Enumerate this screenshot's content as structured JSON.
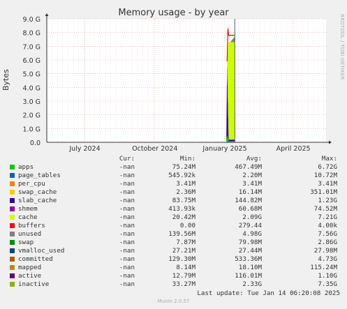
{
  "title": "Memory usage - by year",
  "side_label": "RRDTOOL / TOBI OETIKER",
  "footer": "Munin 2.0.57",
  "last_update": "Last update: Tue Jan 14 06:20:08 2025",
  "legend_headers": {
    "cur": "Cur:",
    "min": "Min:",
    "avg": "Avg:",
    "max": "Max:"
  },
  "legend": [
    {
      "name": "apps",
      "color": "#00cc00",
      "cur": "-nan",
      "min": "75.24M",
      "avg": "467.49M",
      "max": "6.72G"
    },
    {
      "name": "page_tables",
      "color": "#0066b3",
      "cur": "-nan",
      "min": "545.92k",
      "avg": "2.20M",
      "max": "10.72M"
    },
    {
      "name": "per_cpu",
      "color": "#ff8000",
      "cur": "-nan",
      "min": "3.41M",
      "avg": "3.41M",
      "max": "3.41M"
    },
    {
      "name": "swap_cache",
      "color": "#ffcc00",
      "cur": "-nan",
      "min": "2.36M",
      "avg": "16.14M",
      "max": "351.01M"
    },
    {
      "name": "slab_cache",
      "color": "#330099",
      "cur": "-nan",
      "min": "83.75M",
      "avg": "144.82M",
      "max": "1.23G"
    },
    {
      "name": "shmem",
      "color": "#990099",
      "cur": "-nan",
      "min": "413.93k",
      "avg": "60.68M",
      "max": "74.52M"
    },
    {
      "name": "cache",
      "color": "#ccff00",
      "cur": "-nan",
      "min": "20.42M",
      "avg": "2.09G",
      "max": "7.21G"
    },
    {
      "name": "buffers",
      "color": "#ff0000",
      "cur": "-nan",
      "min": "0.00",
      "avg": "279.44",
      "max": "4.00k"
    },
    {
      "name": "unused",
      "color": "#808080",
      "cur": "-nan",
      "min": "139.56M",
      "avg": "4.98G",
      "max": "7.56G"
    },
    {
      "name": "swap",
      "color": "#008f00",
      "cur": "-nan",
      "min": "7.87M",
      "avg": "79.98M",
      "max": "2.86G"
    },
    {
      "name": "vmalloc_used",
      "color": "#00487d",
      "cur": "-nan",
      "min": "27.21M",
      "avg": "27.44M",
      "max": "27.98M"
    },
    {
      "name": "committed",
      "color": "#b35a00",
      "cur": "-nan",
      "min": "129.30M",
      "avg": "533.36M",
      "max": "4.73G"
    },
    {
      "name": "mapped",
      "color": "#b38f00",
      "cur": "-nan",
      "min": "8.14M",
      "avg": "18.10M",
      "max": "115.24M"
    },
    {
      "name": "active",
      "color": "#6b006b",
      "cur": "-nan",
      "min": "12.79M",
      "avg": "116.01M",
      "max": "1.10G"
    },
    {
      "name": "inactive",
      "color": "#8fb300",
      "cur": "-nan",
      "min": "33.27M",
      "avg": "2.33G",
      "max": "7.35G"
    }
  ],
  "chart_data": {
    "type": "area",
    "title": "Memory usage - by year",
    "ylabel": "Bytes",
    "ylim": [
      0,
      9.0
    ],
    "y_unit": "G",
    "yticks": [
      "0.0",
      "1.0 G",
      "2.0 G",
      "3.0 G",
      "4.0 G",
      "5.0 G",
      "6.0 G",
      "7.0 G",
      "8.0 G",
      "9.0 G"
    ],
    "xlim": [
      "2024-05-12",
      "2025-01-14"
    ],
    "xticks": [
      {
        "label": "July 2024",
        "date": "2024-07-01"
      },
      {
        "label": "October 2024",
        "date": "2024-10-01"
      },
      {
        "label": "January 2025",
        "date": "2025-01-01"
      },
      {
        "label": "April 2025",
        "date": "2025-04-01"
      }
    ],
    "grid": true,
    "stacked": true,
    "series": [
      {
        "name": "apps",
        "points": [
          [
            "2025-01-03",
            0.3
          ],
          [
            "2025-01-04",
            0.5
          ],
          [
            "2025-01-06",
            0.1
          ],
          [
            "2025-01-08",
            0.1
          ],
          [
            "2025-01-14",
            0.1
          ]
        ]
      },
      {
        "name": "slab_cache",
        "points": [
          [
            "2025-01-03",
            0.1
          ],
          [
            "2025-01-04",
            5.3
          ],
          [
            "2025-01-06",
            0.1
          ],
          [
            "2025-01-08",
            0.1
          ],
          [
            "2025-01-14",
            0.1
          ]
        ]
      },
      {
        "name": "cache",
        "points": [
          [
            "2025-01-03",
            0.0
          ],
          [
            "2025-01-04",
            0.0
          ],
          [
            "2025-01-06",
            7.1
          ],
          [
            "2025-01-08",
            7.1
          ],
          [
            "2025-01-14",
            7.1
          ]
        ]
      },
      {
        "name": "unused",
        "points": [
          [
            "2025-01-03",
            0.0
          ],
          [
            "2025-01-04",
            0.0
          ],
          [
            "2025-01-06",
            0.0
          ],
          [
            "2025-01-08",
            0.0
          ],
          [
            "2025-01-14",
            0.4
          ]
        ]
      },
      {
        "name": "committed",
        "points": [
          [
            "2025-01-04",
            5.9
          ],
          [
            "2025-01-05",
            8.3
          ],
          [
            "2025-01-06",
            7.8
          ],
          [
            "2025-01-14",
            7.8
          ]
        ]
      }
    ]
  }
}
